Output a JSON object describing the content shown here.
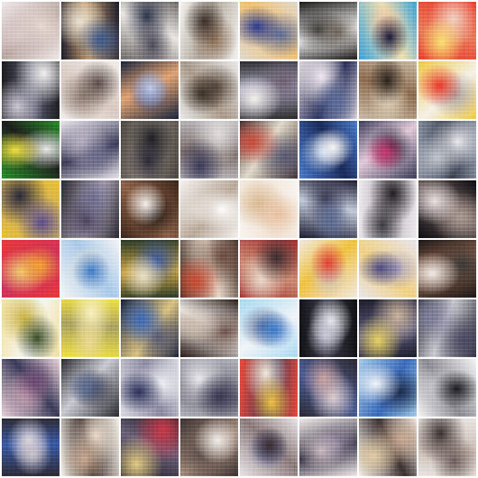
{
  "image": {
    "kind": "gan-sample-grid",
    "rows": 8,
    "cols": 8,
    "tiles": [
      {
        "palette": [
          "#f0e8e8",
          "#d9c9c9",
          "#b8a5a0",
          "#e8d8d0"
        ]
      },
      {
        "palette": [
          "#1a1a2a",
          "#3c5a8c",
          "#c8a070",
          "#e8e0d0"
        ]
      },
      {
        "palette": [
          "#6e6a68",
          "#4c4a58",
          "#e8e4e0",
          "#2c3448"
        ]
      },
      {
        "palette": [
          "#f4f2ee",
          "#3a2e28",
          "#b0a89c",
          "#8c6e58"
        ]
      },
      {
        "palette": [
          "#e0d8cc",
          "#2a3a8c",
          "#f0c070",
          "#5a6a98"
        ]
      },
      {
        "palette": [
          "#1c1a18",
          "#6a6058",
          "#f0f0f0",
          "#3a3834"
        ]
      },
      {
        "palette": [
          "#3aa0d8",
          "#1a1a3a",
          "#f0e0b0",
          "#e8c0a0"
        ]
      },
      {
        "palette": [
          "#e84030",
          "#f8e070",
          "#e87858",
          "#f0d0c0"
        ]
      },
      {
        "palette": [
          "#1c1c20",
          "#c8c4d0",
          "#5a5a70",
          "#f0f0f0"
        ]
      },
      {
        "palette": [
          "#f0ece8",
          "#5a4c48",
          "#d8c8c0",
          "#8c7a70"
        ]
      },
      {
        "palette": [
          "#18243c",
          "#c0c8e0",
          "#e0a070",
          "#3858a8"
        ]
      },
      {
        "palette": [
          "#e8e8e8",
          "#3a3028",
          "#a89888",
          "#5a4c40"
        ]
      },
      {
        "palette": [
          "#2c2a2c",
          "#f4f0ee",
          "#a0a0b8",
          "#6c6070"
        ]
      },
      {
        "palette": [
          "#d8d0d8",
          "#5a6a98",
          "#2a3058",
          "#f0e8f0"
        ]
      },
      {
        "palette": [
          "#c8b8a0",
          "#2a221c",
          "#8a6a50",
          "#e0d0b8"
        ]
      },
      {
        "palette": [
          "#f0c840",
          "#e83828",
          "#f4f0e8",
          "#a8a0a0"
        ]
      },
      {
        "palette": [
          "#2a8c2a",
          "#f0e040",
          "#1c1c1c",
          "#e8e8e8"
        ]
      },
      {
        "palette": [
          "#e8e4ec",
          "#6a6a88",
          "#3c3c58",
          "#c0b8c8"
        ]
      },
      {
        "palette": [
          "#4a4640",
          "#2c2a38",
          "#8a8078",
          "#1c1c20"
        ]
      },
      {
        "palette": [
          "#b8b4b8",
          "#3a3a58",
          "#7a6c68",
          "#e0dcdc"
        ]
      },
      {
        "palette": [
          "#3a2c2c",
          "#c84838",
          "#e0d8c8",
          "#585870"
        ]
      },
      {
        "palette": [
          "#4a78c8",
          "#f4f4f4",
          "#1a2a58",
          "#c8d8f0"
        ]
      },
      {
        "palette": [
          "#3c3c58",
          "#c83870",
          "#e0c8d8",
          "#1a1a2c"
        ]
      },
      {
        "palette": [
          "#8890a0",
          "#c0c4cc",
          "#3a4050",
          "#e8e8ec"
        ]
      },
      {
        "palette": [
          "#e8c030",
          "#5a4c88",
          "#c8a868",
          "#282838"
        ]
      },
      {
        "palette": [
          "#2a2830",
          "#6a6a8c",
          "#a8a0b0",
          "#48405a"
        ]
      },
      {
        "palette": [
          "#3a2418",
          "#f4f0ec",
          "#8a6048",
          "#1c1410"
        ]
      },
      {
        "palette": [
          "#f4f0ee",
          "#e0d8d0",
          "#b8a898",
          "#ffffff"
        ]
      },
      {
        "palette": [
          "#f8f4f0",
          "#e8c0a0",
          "#f0e0d0",
          "#d8b890"
        ]
      },
      {
        "palette": [
          "#1c1c30",
          "#5a6890",
          "#c0c8d8",
          "#383850"
        ]
      },
      {
        "palette": [
          "#ece8ec",
          "#3a3a40",
          "#b8b0b8",
          "#201c20"
        ]
      },
      {
        "palette": [
          "#0c0c10",
          "#e8e0e0",
          "#6a5a58",
          "#a89890"
        ]
      },
      {
        "palette": [
          "#e83838",
          "#f0a030",
          "#c83060",
          "#f0d070"
        ]
      },
      {
        "palette": [
          "#f4f4f4",
          "#3a78c8",
          "#a8c8e8",
          "#e8e0d0"
        ]
      },
      {
        "palette": [
          "#2a3a28",
          "#e8e0c8",
          "#c8a040",
          "#3a58a0"
        ]
      },
      {
        "palette": [
          "#3a2820",
          "#c84830",
          "#e8d8c8",
          "#6a4c40"
        ]
      },
      {
        "palette": [
          "#a03030",
          "#3a2c30",
          "#c88870",
          "#e8d8c8"
        ]
      },
      {
        "palette": [
          "#f0e8e0",
          "#e04030",
          "#f0c040",
          "#c8c0c0"
        ]
      },
      {
        "palette": [
          "#e8e4ec",
          "#4a4a80",
          "#f0d080",
          "#a8a0c0"
        ]
      },
      {
        "palette": [
          "#1c1818",
          "#f0ece8",
          "#8c6048",
          "#3a3838"
        ]
      },
      {
        "palette": [
          "#f0e0a0",
          "#3a4c28",
          "#f8f8f8",
          "#c8b040"
        ]
      },
      {
        "palette": [
          "#f0e040",
          "#e8d890",
          "#a8a060",
          "#f8f0c0"
        ]
      },
      {
        "palette": [
          "#18203a",
          "#3a68b8",
          "#d8c080",
          "#5a5a70"
        ]
      },
      {
        "palette": [
          "#2a1c18",
          "#c8b8a8",
          "#f0ece8",
          "#6a5048"
        ]
      },
      {
        "palette": [
          "#a8d8f0",
          "#3a78c8",
          "#f0f4f8",
          "#5a6890"
        ]
      },
      {
        "palette": [
          "#101014",
          "#c8c8d8",
          "#3a3a48",
          "#f4f4f8"
        ]
      },
      {
        "palette": [
          "#1c1c28",
          "#e8d060",
          "#5a5a80",
          "#c8b098"
        ]
      },
      {
        "palette": [
          "#2a2a34",
          "#7a7a98",
          "#c8c8d0",
          "#484860"
        ]
      },
      {
        "palette": [
          "#e8d0d8",
          "#6a4870",
          "#3a3a58",
          "#c8a0b0"
        ]
      },
      {
        "palette": [
          "#2a2a30",
          "#5a6a90",
          "#c8c8d0",
          "#3a3a48"
        ]
      },
      {
        "palette": [
          "#d8d8e0",
          "#2a3058",
          "#8a88a0",
          "#f0f0f4"
        ]
      },
      {
        "palette": [
          "#b0b0b8",
          "#3a3850",
          "#6a6878",
          "#e8e8ec"
        ]
      },
      {
        "palette": [
          "#e84838",
          "#f0c040",
          "#3a3858",
          "#f4e8d8"
        ]
      },
      {
        "palette": [
          "#2c2830",
          "#c8a0a0",
          "#4a5a90",
          "#e0d0d0"
        ]
      },
      {
        "palette": [
          "#a0c8e8",
          "#f0f4f8",
          "#3a68b8",
          "#1a2a48"
        ]
      },
      {
        "palette": [
          "#f4f4f4",
          "#1a1a20",
          "#8a8890",
          "#c8c8cc"
        ]
      },
      {
        "palette": [
          "#2c2a34",
          "#c8c0c8",
          "#3a58a0",
          "#e8e0e8"
        ]
      },
      {
        "palette": [
          "#f4f0e8",
          "#c8a890",
          "#3a2c28",
          "#e8d8c8"
        ]
      },
      {
        "palette": [
          "#1c1c24",
          "#e0c880",
          "#6a6078",
          "#c83848"
        ]
      },
      {
        "palette": [
          "#3a3030",
          "#f0ece8",
          "#a08878",
          "#5a4c48"
        ]
      },
      {
        "palette": [
          "#e8e4e8",
          "#3a2c2c",
          "#8a7878",
          "#5a68a0"
        ]
      },
      {
        "palette": [
          "#f0e8e8",
          "#c8b8c0",
          "#3a3848",
          "#8a8098"
        ]
      },
      {
        "palette": [
          "#f8f4f0",
          "#e0c8a0",
          "#3a3030",
          "#c8a890"
        ]
      },
      {
        "palette": [
          "#e8e4e0",
          "#6a5c58",
          "#c8b8b0",
          "#3a3030"
        ]
      }
    ]
  }
}
